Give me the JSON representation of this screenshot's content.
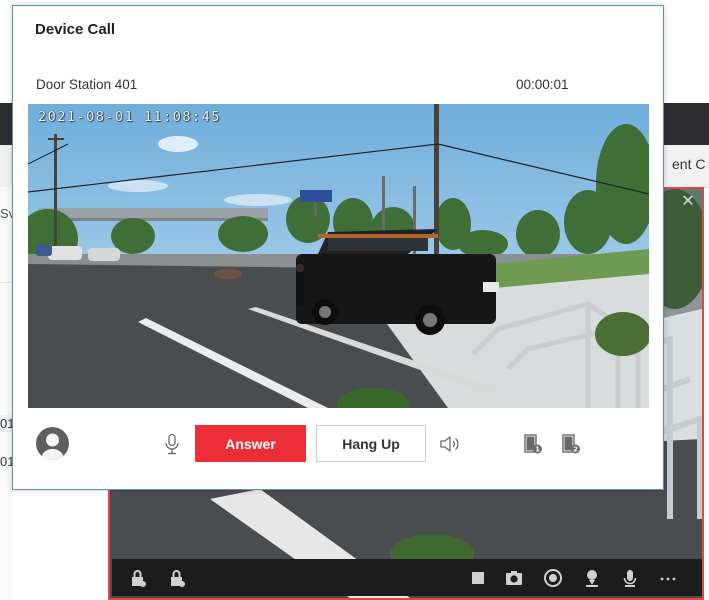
{
  "dialog": {
    "title": "Device Call",
    "device_name": "Door Station 401",
    "call_timer": "00:00:01",
    "video_osd_timestamp": "2021-08-01 11:08:45",
    "answer_label": "Answer",
    "hangup_label": "Hang Up",
    "icons": [
      "avatar-icon",
      "microphone-icon",
      "speaker-icon",
      "door-1-unlock-icon",
      "door-2-unlock-icon"
    ]
  },
  "background_app": {
    "tab_fragment": "ent C",
    "search_fragment": "Sv",
    "list_rows": [
      "01",
      "01"
    ],
    "live_view_close": "✕",
    "toolbar_icons": [
      "lock-icon",
      "lock-icon",
      "stop-icon",
      "camera-icon",
      "record-icon",
      "person-icon",
      "microphone-icon",
      "more-icon"
    ]
  },
  "colors": {
    "accent_red": "#ee2e36",
    "dialog_border": "#5b8ec6",
    "topbar": "#2e2e30",
    "live_view_border": "#e04848"
  }
}
